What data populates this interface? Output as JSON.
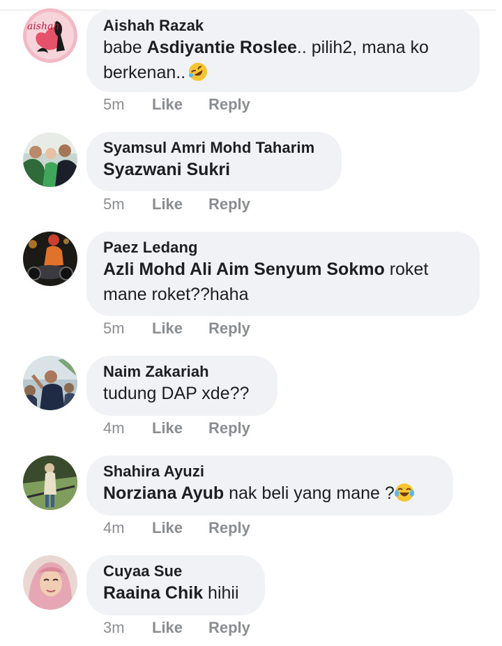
{
  "comments": [
    {
      "author": "Aishah Razak",
      "line1_prefix": "babe ",
      "mention": "Asdiyantie Roslee",
      "line1_suffix": ".. pilih2, mana ko",
      "line2": "berkenan..",
      "emoji": "rolling-on-floor-laughing-emoji",
      "time": "5m",
      "like": "Like",
      "reply": "Reply",
      "avatar_text": "aishah"
    },
    {
      "author": "Syamsul Amri Mohd Taharim",
      "mention": "Syazwani Sukri",
      "time": "5m",
      "like": "Like",
      "reply": "Reply"
    },
    {
      "author": "Paez Ledang",
      "mention": "Azli Mohd Ali Aim Senyum Sokmo",
      "line1_suffix": " roket",
      "line2": "mane roket??haha",
      "time": "5m",
      "like": "Like",
      "reply": "Reply"
    },
    {
      "author": "Naim Zakariah",
      "text": "tudung DAP xde??",
      "time": "4m",
      "like": "Like",
      "reply": "Reply"
    },
    {
      "author": "Shahira Ayuzi",
      "mention": "Norziana Ayub",
      "line1_suffix": " nak beli yang mane ?",
      "emoji": "tears-of-joy-emoji",
      "time": "4m",
      "like": "Like",
      "reply": "Reply"
    },
    {
      "author": "Cuyaa Sue",
      "mention": "Raaina Chik",
      "line1_suffix": " hihii",
      "time": "3m",
      "like": "Like",
      "reply": "Reply"
    }
  ],
  "colors": {
    "bubble": "#f0f2f5",
    "meta_text": "#8a8d91",
    "name_text": "#1c1e21"
  }
}
